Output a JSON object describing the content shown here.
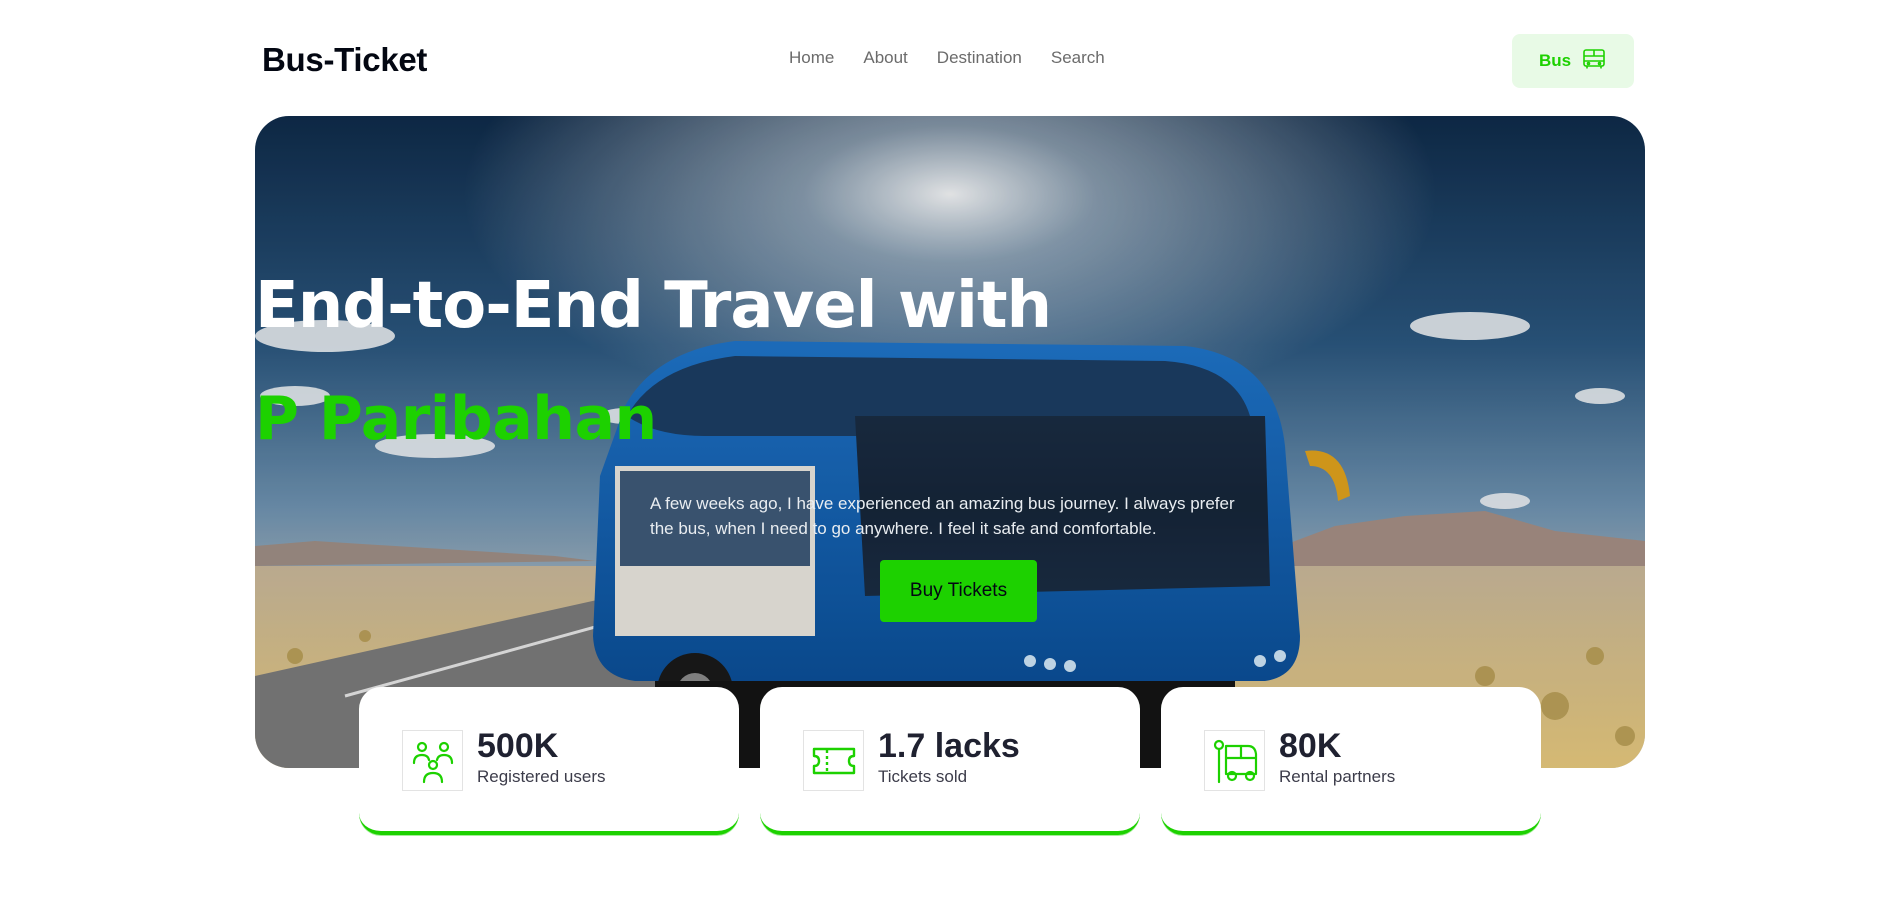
{
  "header": {
    "logo": "Bus-Ticket",
    "nav": [
      "Home",
      "About",
      "Destination",
      "Search"
    ],
    "bus_button_label": "Bus",
    "bus_button_icon": "bus-icon"
  },
  "hero": {
    "title": "End-to-End Travel with",
    "brand": "P Paribahan",
    "description": "A few weeks ago, I have experienced an amazing bus journey. I always prefer the bus, when I need to go anywhere. I feel it safe and comfortable.",
    "cta_label": "Buy Tickets"
  },
  "stats": [
    {
      "value": "500K",
      "label": "Registered users",
      "icon": "users-icon"
    },
    {
      "value": "1.7 lacks",
      "label": "Tickets sold",
      "icon": "ticket-icon"
    },
    {
      "value": "80K",
      "label": "Rental partners",
      "icon": "rental-bus-icon"
    }
  ],
  "colors": {
    "accent": "#1DD100",
    "accent_light": "#E8FAE6",
    "text_dark": "#030712",
    "nav_text": "#6B6B6B"
  }
}
